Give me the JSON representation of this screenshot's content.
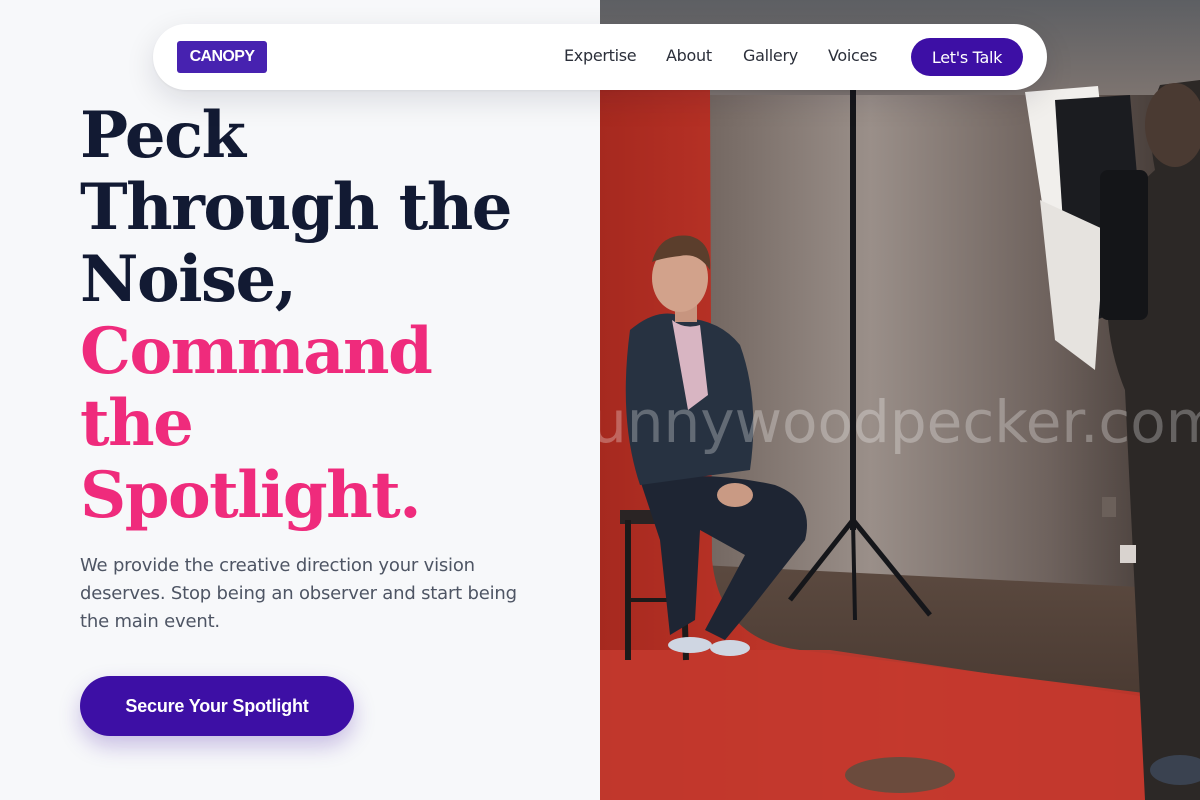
{
  "nav": {
    "logo": "CANOPY",
    "links": [
      "Expertise",
      "About",
      "Gallery",
      "Voices"
    ],
    "cta_label": "Let's Talk"
  },
  "hero": {
    "headline_lines": [
      "Peck",
      "Through the",
      "Noise,"
    ],
    "headline_accent_lines": [
      "Command",
      "the",
      "Spotlight."
    ],
    "subtext": "We provide the creative direction your vision deserves. Stop being an observer and start being the main event.",
    "cta_label": "Secure Your Spotlight"
  },
  "photo": {
    "watermark": "unnywoodpecker.com"
  },
  "colors": {
    "brand": "#4722b0",
    "button": "#3d0fa5",
    "accent": "#ef2b7c",
    "headline": "#121a33",
    "body": "#4e5564",
    "backdrop": "#c53a2e"
  }
}
